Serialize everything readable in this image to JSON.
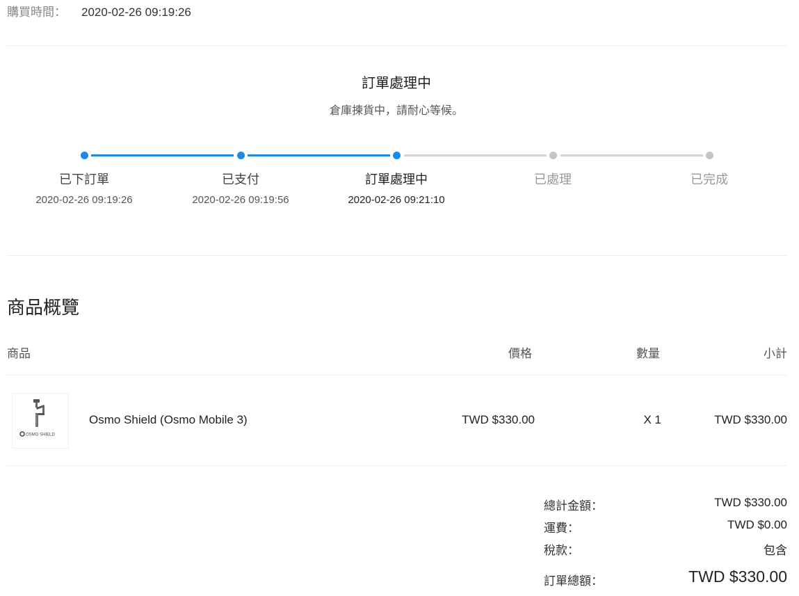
{
  "purchase": {
    "label": "購買時間：",
    "value": "2020-02-26 09:19:26"
  },
  "status": {
    "title": "訂單處理中",
    "subtitle": "倉庫揀貨中，請耐心等候。"
  },
  "steps": [
    {
      "label": "已下訂單",
      "time": "2020-02-26 09:19:26",
      "state": "done"
    },
    {
      "label": "已支付",
      "time": "2020-02-26 09:19:56",
      "state": "done"
    },
    {
      "label": "訂單處理中",
      "time": "2020-02-26 09:21:10",
      "state": "current"
    },
    {
      "label": "已處理",
      "time": "",
      "state": "todo"
    },
    {
      "label": "已完成",
      "time": "",
      "state": "todo"
    }
  ],
  "overview": {
    "title": "商品概覽",
    "headers": {
      "product": "商品",
      "price": "價格",
      "qty": "數量",
      "subtotal": "小計"
    },
    "items": [
      {
        "thumb_text": "OSMO SHIELD",
        "name": "Osmo Shield (Osmo Mobile 3)",
        "price": "TWD $330.00",
        "qty": "X 1",
        "subtotal": "TWD $330.00"
      }
    ]
  },
  "summary": {
    "subtotal_label": "總計金額：",
    "subtotal_value": "TWD $330.00",
    "shipping_label": "運費：",
    "shipping_value": "TWD $0.00",
    "tax_label": "稅款：",
    "tax_value": "包含",
    "total_label": "訂單總額：",
    "total_value": "TWD $330.00"
  },
  "colors": {
    "accent": "#1e88e5",
    "inactive": "#c4c4c4",
    "divider": "#eeeeee"
  }
}
